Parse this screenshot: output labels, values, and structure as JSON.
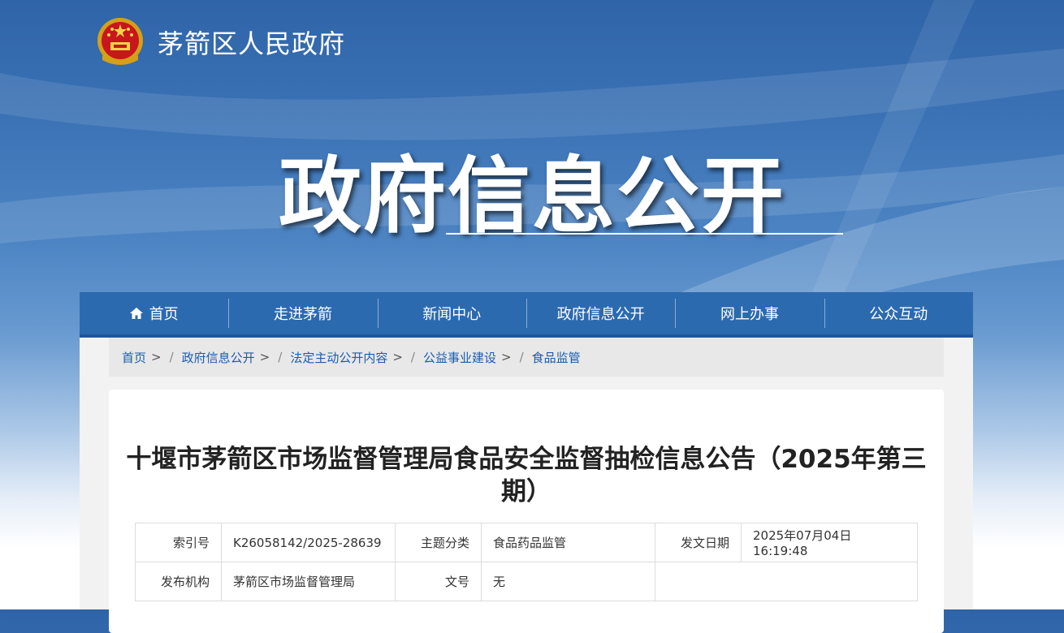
{
  "header": {
    "site_name": "茅箭区人民政府",
    "banner_title": "政府信息公开"
  },
  "nav": {
    "items": [
      {
        "label": "首页",
        "icon": "home-icon"
      },
      {
        "label": "走进茅箭"
      },
      {
        "label": "新闻中心"
      },
      {
        "label": "政府信息公开"
      },
      {
        "label": "网上办事"
      },
      {
        "label": "公众互动"
      }
    ]
  },
  "breadcrumb": {
    "items": [
      "首页",
      "政府信息公开",
      "法定主动公开内容",
      "公益事业建设",
      "食品监管"
    ],
    "separator": ">",
    "divider": "/"
  },
  "article": {
    "title": "十堰市茅箭区市场监督管理局食品安全监督抽检信息公告（2025年第三期）"
  },
  "meta": {
    "index_label": "索引号",
    "index_value": "K26058142/2025-28639",
    "topic_label": "主题分类",
    "topic_value": "食品药品监管",
    "date_label": "发文日期",
    "date_value": "2025年07月04日 16:19:48",
    "org_label": "发布机构",
    "org_value": "茅箭区市场监督管理局",
    "doc_label": "文号",
    "doc_value": "无"
  },
  "colors": {
    "nav_bg": "#2c6ab0",
    "link": "#1a5cb0"
  }
}
